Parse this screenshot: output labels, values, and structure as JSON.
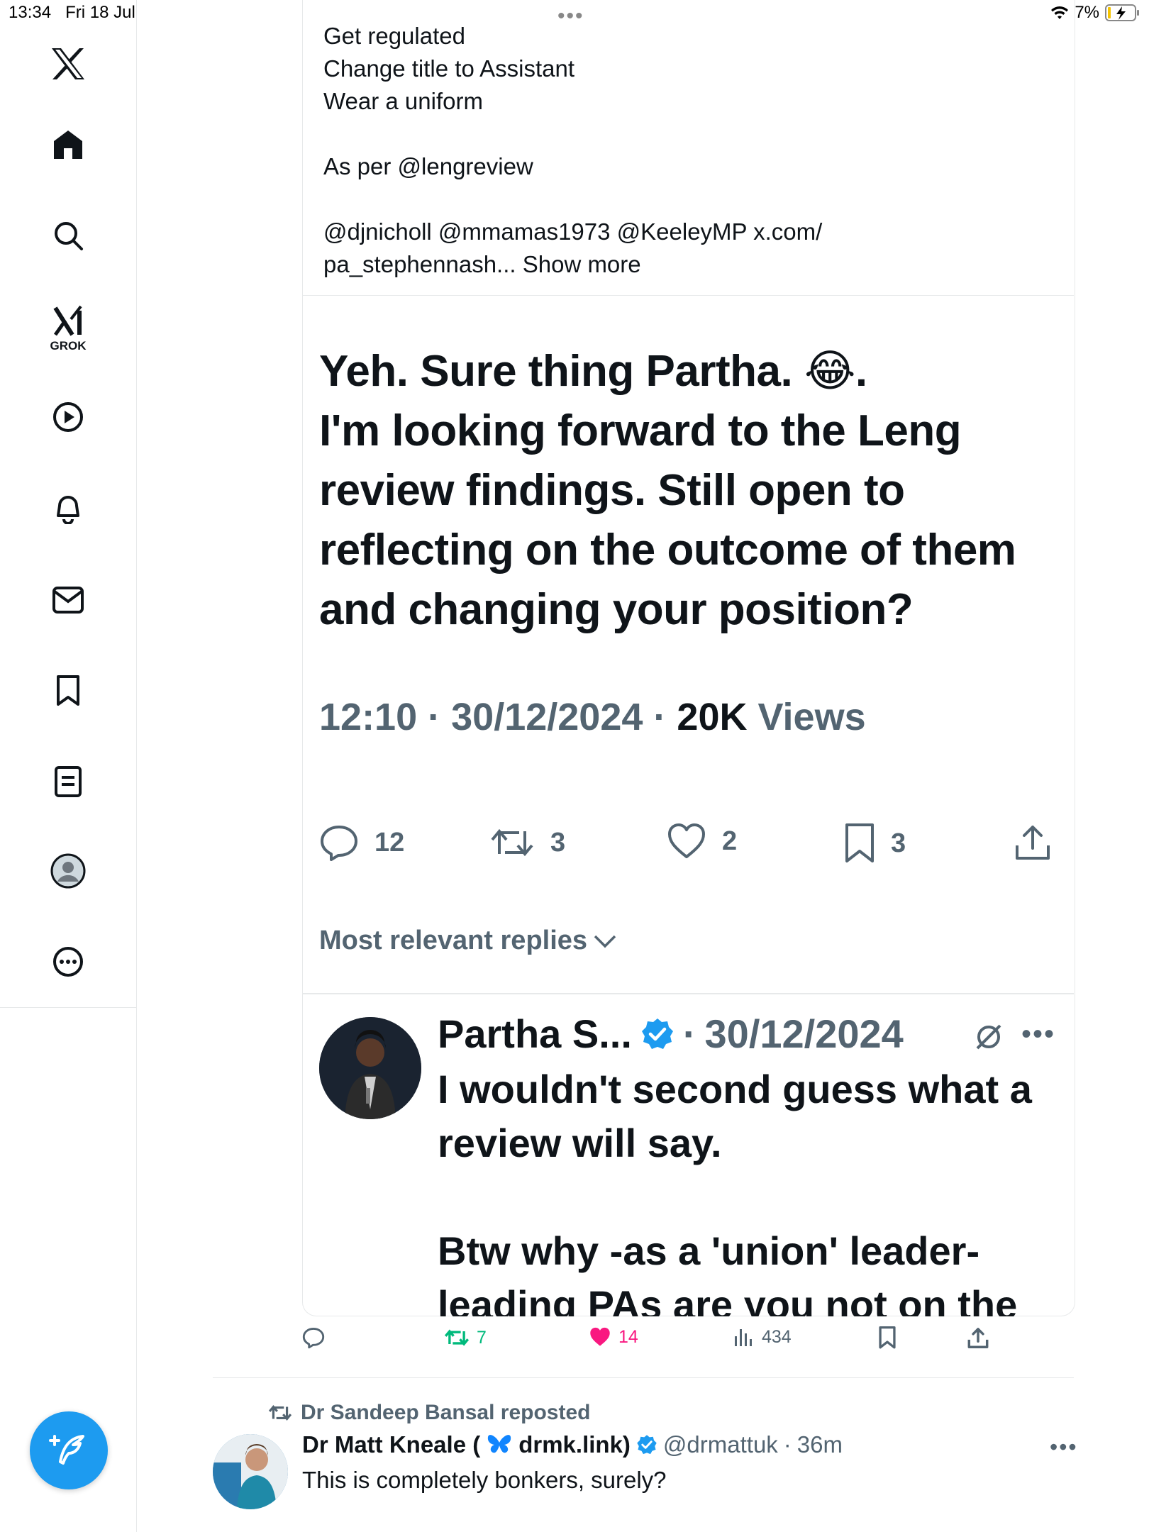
{
  "status_bar": {
    "time": "13:34",
    "date": "Fri 18 Jul",
    "battery": "7%"
  },
  "sidebar": {
    "logo": "x-logo-icon",
    "grok_label": "GROK",
    "items": [
      "home-icon",
      "search-icon",
      "grok-icon",
      "video-icon",
      "notifications-icon",
      "messages-icon",
      "bookmarks-icon",
      "lists-icon",
      "profile-icon",
      "more-icon"
    ]
  },
  "context_text": {
    "lines": [
      "Get regulated",
      "Change title to Assistant",
      "Wear a uniform",
      "",
      "As per @lengreview",
      "",
      "@djnicholl @mmamas1973 @KeeleyMP x.com/",
      "pa_stephennash... Show more"
    ]
  },
  "main_tweet": {
    "text_part1": "Yeh. Sure thing Partha. ",
    "emoji": "😂",
    "text_part2": ".\nI'm looking forward to the Leng review findings. Still open to reflecting on the outcome of them and changing your position?",
    "time": "12:10",
    "date": "30/12/2024",
    "views_count": "20K",
    "views_label": "Views",
    "dot": "·"
  },
  "tweet_actions": {
    "replies": "12",
    "reposts": "3",
    "likes": "2",
    "bookmarks": "3"
  },
  "sort_label": "Most relevant replies",
  "reply": {
    "name": "Partha S...",
    "dot": "·",
    "date": "30/12/2024",
    "lines": [
      "I wouldn't second guess what a",
      "review will say.",
      "",
      "Btw why -as a 'union' leader-",
      "leading PAs are you not on the"
    ]
  },
  "quote_actions": {
    "reposts": "7",
    "likes": "14",
    "views": "434"
  },
  "feed": {
    "reposted_by": "Dr Sandeep Bansal reposted",
    "name_start": "Dr Matt Kneale (",
    "name_link": "drmk.link)",
    "handle": "@drmattuk",
    "dot": "·",
    "time": "36m",
    "text": "This is completely bonkers, surely?"
  },
  "colors": {
    "accent": "#1d9bf0",
    "like": "#f91880",
    "repost": "#00ba7c",
    "muted": "#536471"
  }
}
